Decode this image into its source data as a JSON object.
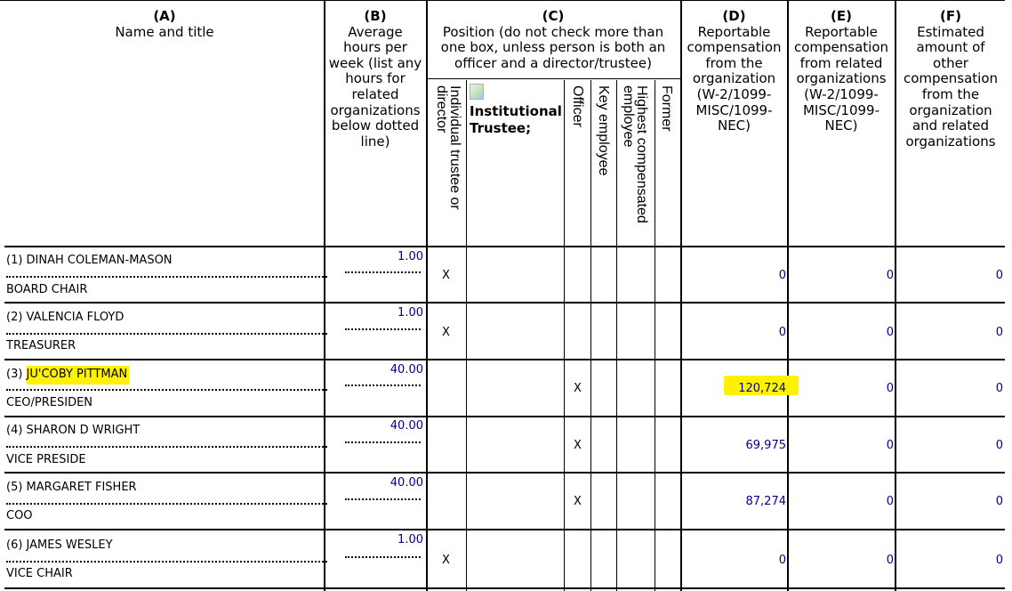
{
  "columns": {
    "a": {
      "letter": "(A)",
      "label": "Name and title"
    },
    "b": {
      "letter": "(B)",
      "label": "Average hours per week (list any hours for related organizations below dotted line)"
    },
    "c": {
      "letter": "(C)",
      "label": "Position (do not check more than one box, unless person is both an officer and a director/trustee)"
    },
    "d": {
      "letter": "(D)",
      "label": "Reportable compensation from the organization (W-2/1099-MISC/1099-NEC)"
    },
    "e": {
      "letter": "(E)",
      "label": "Reportable compensation from related organizations (W-2/1099-MISC/1099-NEC)"
    },
    "f": {
      "letter": "(F)",
      "label": "Estimated amount of other compensation from the organization and related organizations"
    }
  },
  "positions": {
    "individual": "Individual trustee or director",
    "institutional": "Institutional Trustee;",
    "officer": "Officer",
    "key": "Key employee",
    "highest": "Highest compensated employee",
    "former": "Former"
  },
  "check_mark": "X",
  "rows": [
    {
      "name": "(1) DINAH COLEMAN-MASON",
      "title": "BOARD CHAIR",
      "hours": "1.00",
      "position": "individual",
      "comp_d": "0",
      "comp_e": "0",
      "comp_f": "0"
    },
    {
      "name": "(2) VALENCIA FLOYD",
      "title": "TREASURER",
      "hours": "1.00",
      "position": "individual",
      "comp_d": "0",
      "comp_e": "0",
      "comp_f": "0"
    },
    {
      "name_prefix": "(3) ",
      "name_highlight": "JU'COBY PITTMAN",
      "title": "CEO/PRESIDEN",
      "hours": "40.00",
      "position": "officer",
      "comp_d": "120,724",
      "comp_e": "0",
      "comp_f": "0"
    },
    {
      "name": "(4) SHARON D WRIGHT",
      "title": "VICE PRESIDE",
      "hours": "40.00",
      "position": "officer",
      "comp_d": "69,975",
      "comp_e": "0",
      "comp_f": "0"
    },
    {
      "name": "(5) MARGARET FISHER",
      "title": "COO",
      "hours": "40.00",
      "position": "officer",
      "comp_d": "87,274",
      "comp_e": "0",
      "comp_f": "0"
    },
    {
      "name": "(6) JAMES WESLEY",
      "title": "VICE CHAIR",
      "hours": "1.00",
      "position": "individual",
      "comp_d": "0",
      "comp_e": "0",
      "comp_f": "0"
    }
  ],
  "colors": {
    "text": "#000000",
    "number": "#00008b",
    "highlight": "#fff200"
  }
}
